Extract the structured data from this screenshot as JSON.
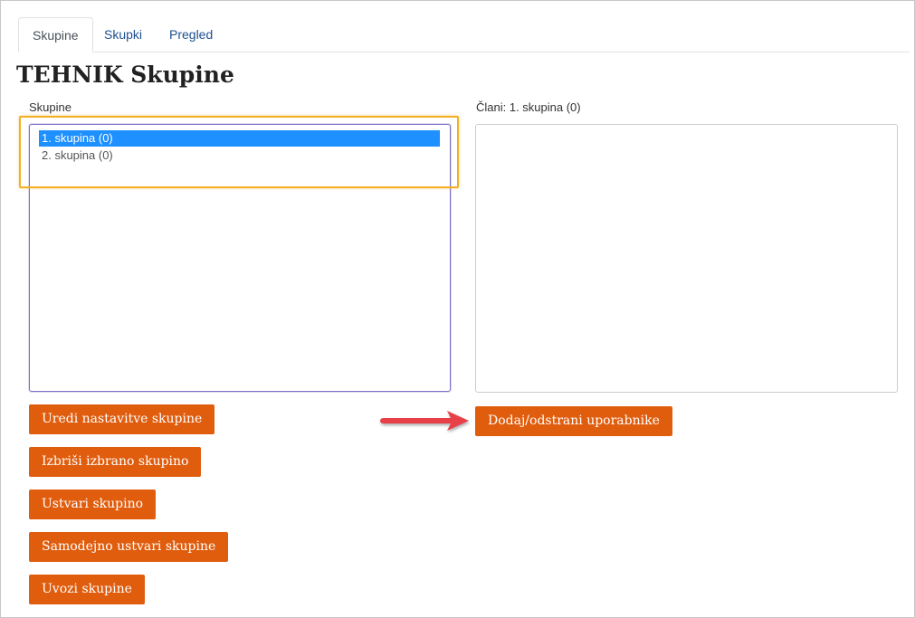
{
  "tabs": [
    {
      "label": "Skupine",
      "active": true
    },
    {
      "label": "Skupki",
      "active": false
    },
    {
      "label": "Pregled",
      "active": false
    }
  ],
  "page_title": "TEHNIK Skupine",
  "groups_panel": {
    "label": "Skupine",
    "options": [
      {
        "label": "1. skupina (0)",
        "selected": true
      },
      {
        "label": "2. skupina (0)",
        "selected": false
      }
    ]
  },
  "members_panel": {
    "label": "Člani: 1. skupina (0)"
  },
  "buttons": {
    "edit_settings": "Uredi nastavitve skupine",
    "delete_selected": "Izbriši izbrano skupino",
    "create_group": "Ustvari skupino",
    "auto_create": "Samodejno ustvari skupine",
    "import_groups": "Uvozi skupine",
    "add_remove_users": "Dodaj/odstrani uporabnike"
  },
  "colors": {
    "button_bg": "#e05d0e",
    "selected_option_bg": "#1e90ff",
    "highlight_border": "#f4b024",
    "arrow": "#e8414a"
  }
}
